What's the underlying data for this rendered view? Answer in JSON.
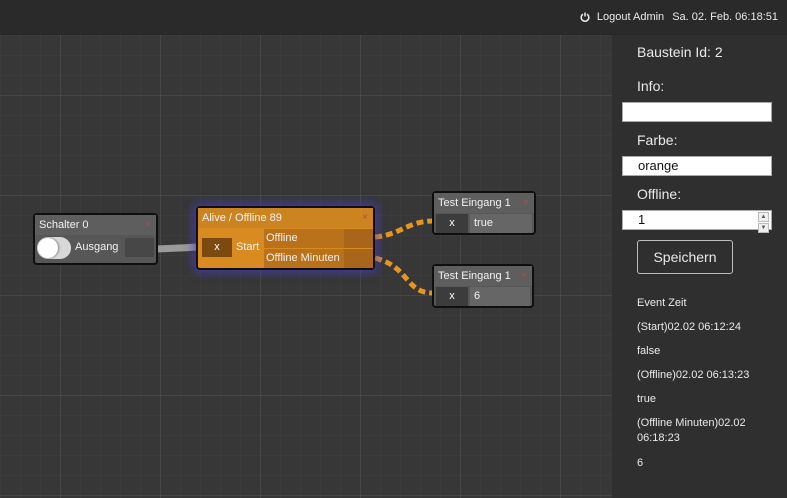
{
  "header": {
    "logout_label": "Logout Admin",
    "datetime": "Sa. 02. Feb. 06:18:51",
    "power_icon": "power-icon"
  },
  "canvas": {
    "wire_colors": {
      "gray": "#9a9a9a",
      "orange": "#e8951d"
    },
    "nodes": {
      "schalter": {
        "title": "Schalter 0",
        "output_label": "Ausgang",
        "toggle_state": "off"
      },
      "alive": {
        "title": "Alive / Offline 89",
        "input_x": "x",
        "input_label": "Start",
        "output_1": "Offline",
        "output_2": "Offline Minuten",
        "color": "#d98a20"
      },
      "test1": {
        "title": "Test Eingang 1",
        "input_x": "x",
        "value": "true"
      },
      "test2": {
        "title": "Test Eingang 1",
        "input_x": "x",
        "value": "6"
      }
    },
    "close_glyph": "×"
  },
  "panel": {
    "block_id_label": "Baustein Id: 2",
    "info_label": "Info:",
    "info_value": "",
    "color_label": "Farbe:",
    "color_value": "orange",
    "offline_label": "Offline:",
    "offline_value": "1",
    "save_label": "Speichern",
    "events_header": "Event Zeit",
    "events": [
      "(Start)02.02 06:12:24",
      "false",
      "(Offline)02.02 06:13:23",
      "true",
      "(Offline Minuten)02.02 06:18:23",
      "6"
    ]
  }
}
